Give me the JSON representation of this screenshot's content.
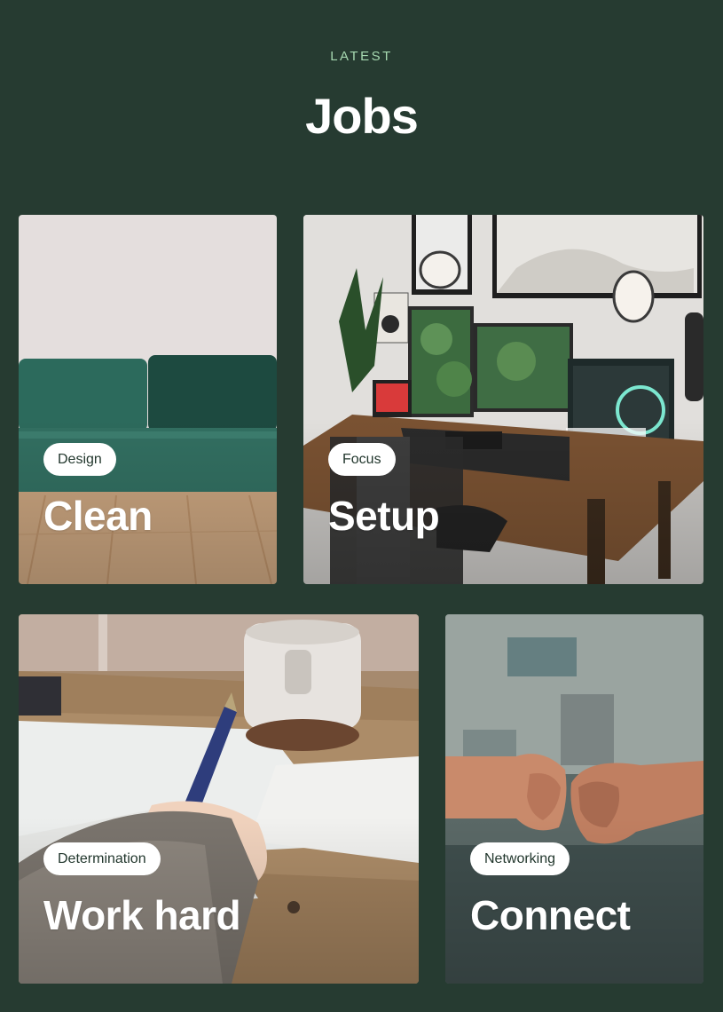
{
  "section": {
    "eyebrow": "LATEST",
    "title": "Jobs"
  },
  "cards": [
    {
      "tag": "Design",
      "title": "Clean",
      "image": "green-sofa-photo"
    },
    {
      "tag": "Focus",
      "title": "Setup",
      "image": "desk-setup-photo"
    },
    {
      "tag": "Determination",
      "title": "Work hard",
      "image": "writing-desk-photo"
    },
    {
      "tag": "Networking",
      "title": "Connect",
      "image": "fist-bump-photo"
    }
  ],
  "colors": {
    "background": "#263b31",
    "accent": "#a7d9b1",
    "tag_text": "#22372d"
  }
}
